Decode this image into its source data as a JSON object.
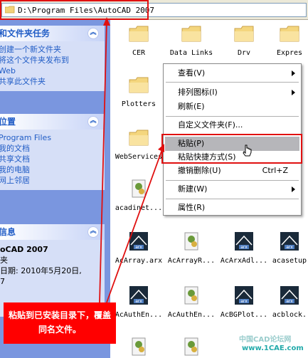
{
  "address": {
    "path": "D:\\Program Files\\AutoCAD 2007"
  },
  "tasks_panel": {
    "title": "和文件夹任务",
    "items": [
      "创建一个新文件夹",
      "将这个文件夹发布到",
      "Web",
      "共享此文件夹"
    ]
  },
  "places_panel": {
    "title": "位置",
    "items": [
      "Program Files",
      "我的文档",
      "共享文档",
      "我的电脑",
      "网上邻居"
    ]
  },
  "details_panel": {
    "title": "信息",
    "name": "oCAD 2007",
    "type": "夹",
    "date_line": "日期: 2010年5月20日,",
    "time_line": "7"
  },
  "files": [
    {
      "label": "CER",
      "icon": "folder-icon"
    },
    {
      "label": "Data Links",
      "icon": "folder-icon"
    },
    {
      "label": "Drv",
      "icon": "folder-icon"
    },
    {
      "label": "Expres",
      "icon": "folder-icon"
    },
    {
      "label": "Plotters",
      "icon": "folder-icon"
    },
    {
      "label": "WebServices",
      "icon": "folder-icon"
    },
    {
      "label": "acadinet...",
      "icon": "dll-icon"
    },
    {
      "label": "AcArray.arx",
      "icon": "arx-icon"
    },
    {
      "label": "AcArrayR...",
      "icon": "dll-icon"
    },
    {
      "label": "AcArxAdl...",
      "icon": "arx-icon"
    },
    {
      "label": "acasetup",
      "icon": "arx-icon"
    },
    {
      "label": "AcAuthEn...",
      "icon": "arx-icon"
    },
    {
      "label": "AcAuthEn...",
      "icon": "dll-icon"
    },
    {
      "label": "AcBGPlot...",
      "icon": "arx-icon"
    },
    {
      "label": "acblock.",
      "icon": "arx-icon"
    }
  ],
  "context_menu": {
    "items": [
      {
        "label": "查看(V)",
        "shortcut": "",
        "submenu": true
      },
      {
        "label": "排列图标(I)",
        "shortcut": "",
        "submenu": true
      },
      {
        "label": "刷新(E)",
        "shortcut": "",
        "submenu": false
      },
      {
        "label": "自定义文件夹(F)...",
        "shortcut": "",
        "submenu": false
      },
      {
        "label": "粘贴(P)",
        "shortcut": "",
        "submenu": false,
        "selected": true
      },
      {
        "label": "粘贴快捷方式(S)",
        "shortcut": "",
        "submenu": false
      },
      {
        "label": "撤销删除(U)",
        "shortcut": "Ctrl+Z",
        "submenu": false
      },
      {
        "label": "新建(W)",
        "shortcut": "",
        "submenu": true
      },
      {
        "label": "属性(R)",
        "shortcut": "",
        "submenu": false
      }
    ]
  },
  "annotation": {
    "text": "粘贴到已安装目录下，覆盖同名文件。"
  },
  "watermark": {
    "line1": "中国CAD论坛网",
    "line2": "www.1CAE.com"
  },
  "colors": {
    "highlight_red": "#e01010",
    "pane_blue": "#7a96df",
    "link_blue": "#215dc6"
  }
}
